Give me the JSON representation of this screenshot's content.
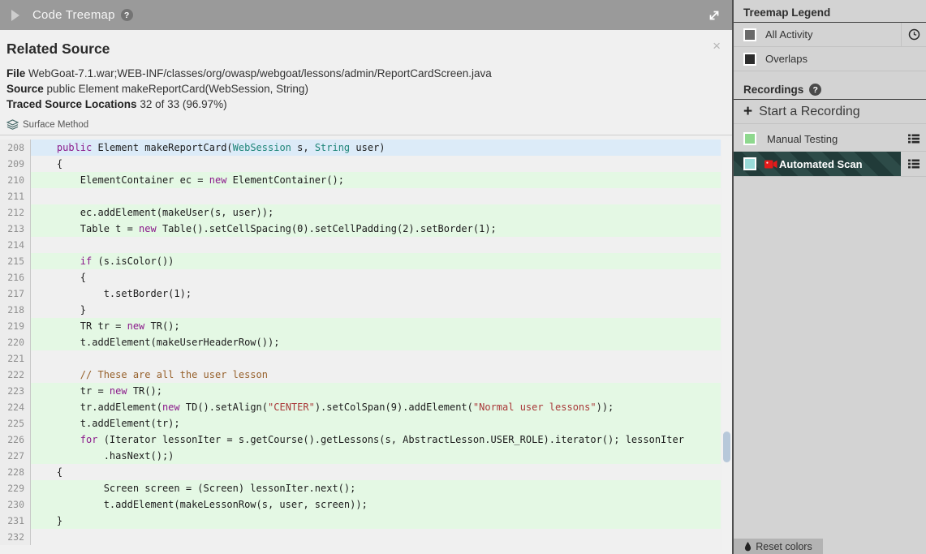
{
  "header": {
    "title": "Code Treemap",
    "help_icon": "?"
  },
  "related_source": {
    "title": "Related Source",
    "file_label": "File",
    "file_value": "WebGoat-7.1.war;WEB-INF/classes/org/owasp/webgoat/lessons/admin/ReportCardScreen.java",
    "source_label": "Source",
    "source_value": "public Element makeReportCard(WebSession, String)",
    "traced_label": "Traced Source Locations",
    "traced_value": "32 of 33 (96.97%)",
    "surface_method_label": "Surface Method",
    "close_icon": "×"
  },
  "colors": {
    "traced_line_highlight": "#e4f8e4",
    "active_line_highlight": "#dcebf8",
    "recording_selected_stripe": "#2d4b48",
    "header_bar": "#9a9a9a",
    "record_icon_red": "#e31b1b"
  },
  "code": {
    "lines": [
      {
        "num": 208,
        "bg": "blue",
        "segs": [
          {
            "t": "    "
          },
          {
            "t": "public",
            "c": "k"
          },
          {
            "t": " Element makeReportCard("
          },
          {
            "t": "WebSession",
            "c": "y"
          },
          {
            "t": " s, "
          },
          {
            "t": "String",
            "c": "y"
          },
          {
            "t": " user)"
          }
        ]
      },
      {
        "num": 209,
        "bg": "none",
        "segs": [
          {
            "t": "    {"
          }
        ]
      },
      {
        "num": 210,
        "bg": "green",
        "segs": [
          {
            "t": "        ElementContainer ec = "
          },
          {
            "t": "new",
            "c": "k"
          },
          {
            "t": " ElementContainer();"
          }
        ]
      },
      {
        "num": 211,
        "bg": "none",
        "segs": []
      },
      {
        "num": 212,
        "bg": "green",
        "segs": [
          {
            "t": "        ec.addElement(makeUser(s, user));"
          }
        ]
      },
      {
        "num": 213,
        "bg": "green",
        "segs": [
          {
            "t": "        Table t = "
          },
          {
            "t": "new",
            "c": "k"
          },
          {
            "t": " Table().setCellSpacing(0).setCellPadding(2).setBorder(1);"
          }
        ]
      },
      {
        "num": 214,
        "bg": "none",
        "segs": []
      },
      {
        "num": 215,
        "bg": "green",
        "segs": [
          {
            "t": "        "
          },
          {
            "t": "if",
            "c": "k"
          },
          {
            "t": " (s.isColor())"
          }
        ]
      },
      {
        "num": 216,
        "bg": "none",
        "segs": [
          {
            "t": "        {"
          }
        ]
      },
      {
        "num": 217,
        "bg": "none",
        "segs": [
          {
            "t": "            t.setBorder(1);"
          }
        ]
      },
      {
        "num": 218,
        "bg": "none",
        "segs": [
          {
            "t": "        }"
          }
        ]
      },
      {
        "num": 219,
        "bg": "green",
        "segs": [
          {
            "t": "        TR tr = "
          },
          {
            "t": "new",
            "c": "k"
          },
          {
            "t": " TR();"
          }
        ]
      },
      {
        "num": 220,
        "bg": "green",
        "segs": [
          {
            "t": "        t.addElement(makeUserHeaderRow());"
          }
        ]
      },
      {
        "num": 221,
        "bg": "none",
        "segs": []
      },
      {
        "num": 222,
        "bg": "none",
        "segs": [
          {
            "t": "        // These are all the user lesson",
            "c": "c"
          }
        ]
      },
      {
        "num": 223,
        "bg": "green",
        "segs": [
          {
            "t": "        tr = "
          },
          {
            "t": "new",
            "c": "k"
          },
          {
            "t": " TR();"
          }
        ]
      },
      {
        "num": 224,
        "bg": "green",
        "segs": [
          {
            "t": "        tr.addElement("
          },
          {
            "t": "new",
            "c": "k"
          },
          {
            "t": " TD().setAlign("
          },
          {
            "t": "\"CENTER\"",
            "c": "s"
          },
          {
            "t": ").setColSpan(9).addElement("
          },
          {
            "t": "\"Normal user lessons\"",
            "c": "s"
          },
          {
            "t": "));"
          }
        ]
      },
      {
        "num": 225,
        "bg": "green",
        "segs": [
          {
            "t": "        t.addElement(tr);"
          }
        ]
      },
      {
        "num": 226,
        "bg": "green",
        "segs": [
          {
            "t": "        "
          },
          {
            "t": "for",
            "c": "k"
          },
          {
            "t": " (Iterator lessonIter = s.getCourse().getLessons(s, AbstractLesson.USER_ROLE).iterator(); lessonIter"
          }
        ]
      },
      {
        "num": 227,
        "bg": "green",
        "segs": [
          {
            "t": "            .hasNext();)"
          }
        ]
      },
      {
        "num": 228,
        "bg": "none",
        "segs": [
          {
            "t": "    {"
          }
        ]
      },
      {
        "num": 229,
        "bg": "green",
        "segs": [
          {
            "t": "            Screen screen = (Screen) lessonIter.next();"
          }
        ]
      },
      {
        "num": 230,
        "bg": "green",
        "segs": [
          {
            "t": "            t.addElement(makeLessonRow(s, user, screen));"
          }
        ]
      },
      {
        "num": 231,
        "bg": "green",
        "segs": [
          {
            "t": "    }"
          }
        ]
      },
      {
        "num": 232,
        "bg": "none",
        "segs": []
      }
    ]
  },
  "sidebar": {
    "legend": {
      "title": "Treemap Legend",
      "items": [
        {
          "label": "All Activity",
          "swatch": "#6a6a6a"
        },
        {
          "label": "Overlaps",
          "swatch": "#2d2d2d"
        }
      ]
    },
    "recordings": {
      "title": "Recordings",
      "help_icon": "?",
      "start_label": "Start a Recording",
      "items": [
        {
          "label": "Manual Testing",
          "swatch": "#8ed88e",
          "selected": false
        },
        {
          "label": "Automated Scan",
          "swatch": "#9adbd8",
          "selected": true
        }
      ]
    },
    "reset_button": {
      "label": "Reset colors"
    }
  }
}
